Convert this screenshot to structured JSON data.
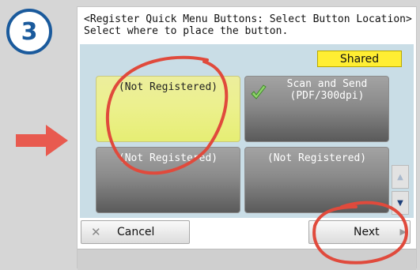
{
  "step": {
    "number": "3"
  },
  "dialog": {
    "title": "<Register Quick Menu Buttons: Select Button Location>",
    "subtitle": "Select where to place the button.",
    "shared_label": "Shared"
  },
  "slots": [
    {
      "label": "(Not Registered)",
      "selected": true
    },
    {
      "line1": "Scan and Send",
      "line2": "(PDF/300dpi)",
      "icon": "scan-send-icon"
    },
    {
      "label": "(Not Registered)"
    },
    {
      "label": "(Not Registered)"
    }
  ],
  "buttons": {
    "cancel": "Cancel",
    "next": "Next"
  },
  "colors": {
    "accent_blue": "#1a5a9c",
    "arrow_red": "#e85a4f",
    "circle_red": "#e04a3c",
    "shared_yellow": "#ffee33",
    "selected_slot": "#ecf08e"
  }
}
